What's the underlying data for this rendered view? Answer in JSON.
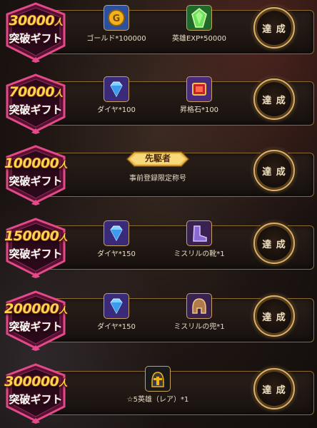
{
  "rows": [
    {
      "number": "30000",
      "unit": "人",
      "subtitle": "突破ギフト",
      "items": [
        {
          "icon": "gold-coin-icon",
          "label": "ゴールド*100000"
        },
        {
          "icon": "hero-exp-icon",
          "label": "英雄EXP*50000"
        }
      ],
      "button": "達 成"
    },
    {
      "number": "70000",
      "unit": "人",
      "subtitle": "突破ギフト",
      "items": [
        {
          "icon": "diamond-icon",
          "label": "ダイヤ*100"
        },
        {
          "icon": "promotion-stone-icon",
          "label": "昇格石*100"
        }
      ],
      "button": "達 成"
    },
    {
      "number": "100000",
      "unit": "人",
      "subtitle": "突破ギフト",
      "items": [
        {
          "icon": "pioneer-title-icon",
          "label": "事前登録限定称号",
          "badge_text": "先駆者"
        }
      ],
      "button": "達 成"
    },
    {
      "number": "150000",
      "unit": "人",
      "subtitle": "突破ギフト",
      "items": [
        {
          "icon": "diamond-icon",
          "label": "ダイヤ*150"
        },
        {
          "icon": "mithril-boots-icon",
          "label": "ミスリルの靴*1"
        }
      ],
      "button": "達 成"
    },
    {
      "number": "200000",
      "unit": "人",
      "subtitle": "突破ギフト",
      "items": [
        {
          "icon": "diamond-icon",
          "label": "ダイヤ*150"
        },
        {
          "icon": "mithril-helmet-icon",
          "label": "ミスリルの兜*1"
        }
      ],
      "button": "達 成"
    },
    {
      "number": "300000",
      "unit": "人",
      "subtitle": "突破ギフト",
      "items": [
        {
          "icon": "hero-helmet-icon",
          "label": "☆5英雄（レア）*1"
        }
      ],
      "button": "達 成"
    }
  ],
  "colors": {
    "gold": "#ffd34a",
    "panel_border": "#8c6a2e",
    "badge_frame": "#e24a8a"
  }
}
